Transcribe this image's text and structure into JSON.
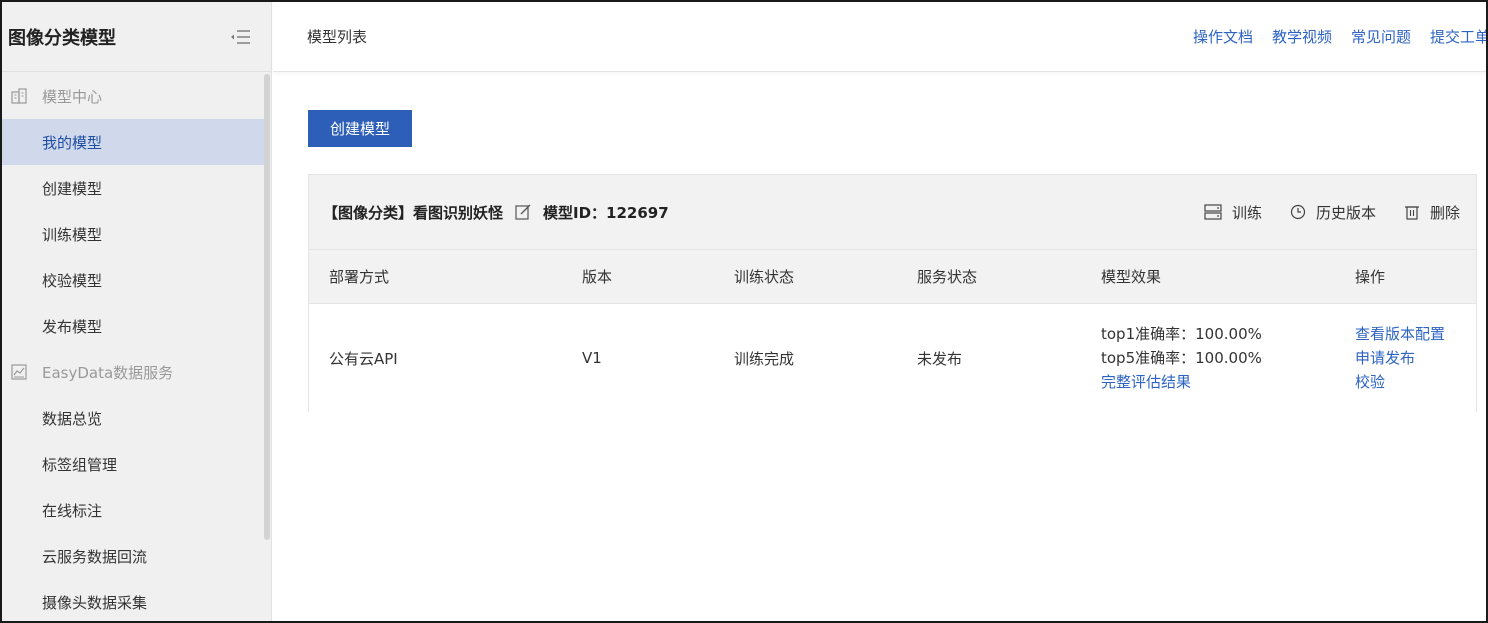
{
  "sidebar": {
    "title": "图像分类模型",
    "groups": [
      {
        "label": "模型中心",
        "items": [
          {
            "label": "我的模型",
            "active": true
          },
          {
            "label": "创建模型"
          },
          {
            "label": "训练模型"
          },
          {
            "label": "校验模型"
          },
          {
            "label": "发布模型"
          }
        ]
      },
      {
        "label": "EasyData数据服务",
        "items": [
          {
            "label": "数据总览"
          },
          {
            "label": "标签组管理"
          },
          {
            "label": "在线标注"
          },
          {
            "label": "云服务数据回流"
          },
          {
            "label": "摄像头数据采集"
          }
        ]
      }
    ]
  },
  "header": {
    "title": "模型列表",
    "links": [
      "操作文档",
      "教学视频",
      "常见问题",
      "提交工单"
    ]
  },
  "main": {
    "create_button": "创建模型",
    "model": {
      "name": "【图像分类】看图识别妖怪",
      "id_text": "模型ID：122697",
      "actions": {
        "train": "训练",
        "history": "历史版本",
        "delete": "删除"
      },
      "columns": [
        "部署方式",
        "版本",
        "训练状态",
        "服务状态",
        "模型效果",
        "操作"
      ],
      "row": {
        "deploy": "公有云API",
        "version": "V1",
        "train_status": "训练完成",
        "service_status": "未发布",
        "top1": "top1准确率：100.00%",
        "top5": "top5准确率：100.00%",
        "full_eval": "完整评估结果",
        "ops": [
          "查看版本配置",
          "申请发布",
          "校验"
        ]
      }
    }
  },
  "colors": {
    "accent": "#2e5fb8",
    "link": "#2d64c4",
    "active_bg": "#cfd9eb",
    "sidebar_bg": "#f0f0f0"
  }
}
